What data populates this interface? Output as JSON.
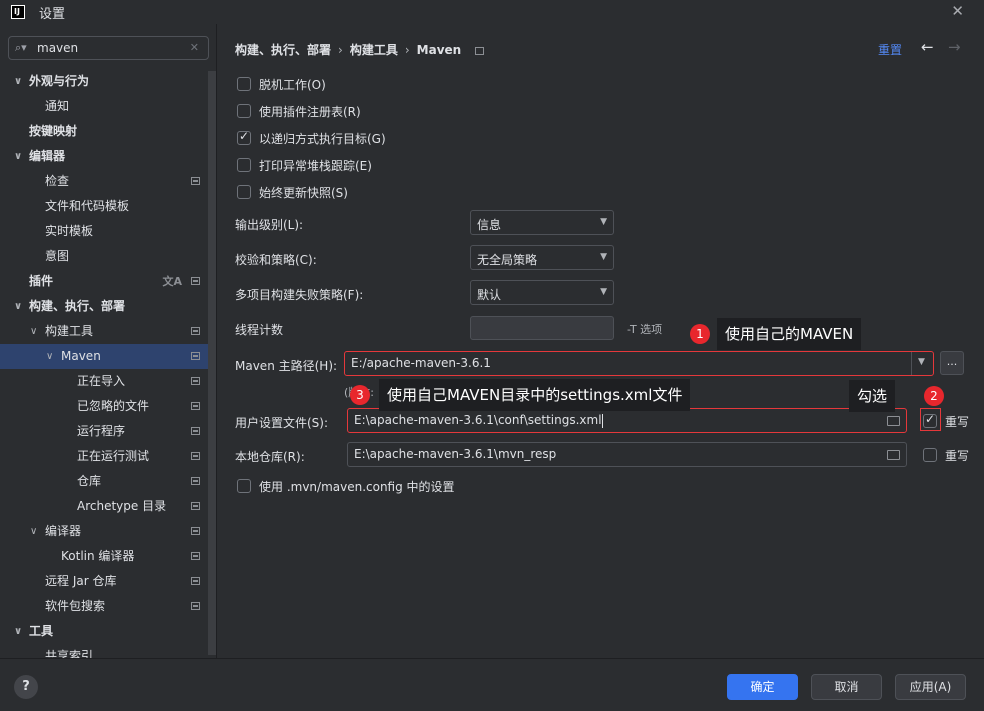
{
  "window": {
    "title": "设置",
    "logo": "IJ"
  },
  "search": {
    "value": "maven"
  },
  "sidebar": {
    "items": [
      {
        "label": "外观与行为",
        "expanded": true,
        "bold": true
      },
      {
        "label": "通知"
      },
      {
        "label": "按键映射",
        "bold": true
      },
      {
        "label": "编辑器",
        "expanded": true,
        "bold": true
      },
      {
        "label": "检查"
      },
      {
        "label": "文件和代码模板"
      },
      {
        "label": "实时模板"
      },
      {
        "label": "意图"
      },
      {
        "label": "插件",
        "bold": true
      },
      {
        "label": "构建、执行、部署",
        "expanded": true,
        "bold": true
      },
      {
        "label": "构建工具",
        "expanded": true
      },
      {
        "label": "Maven",
        "expanded": true,
        "selected": true
      },
      {
        "label": "正在导入"
      },
      {
        "label": "已忽略的文件"
      },
      {
        "label": "运行程序"
      },
      {
        "label": "正在运行测试"
      },
      {
        "label": "仓库"
      },
      {
        "label": "Archetype 目录"
      },
      {
        "label": "编译器",
        "expanded": true
      },
      {
        "label": "Kotlin 编译器"
      },
      {
        "label": "远程 Jar 仓库"
      },
      {
        "label": "软件包搜索"
      },
      {
        "label": "工具",
        "expanded": true,
        "bold": true
      },
      {
        "label": "共享索引"
      }
    ]
  },
  "breadcrumb": {
    "part1": "构建、执行、部署",
    "part2": "构建工具",
    "part3": "Maven",
    "sep": "›"
  },
  "header": {
    "reset": "重置"
  },
  "checkboxes": {
    "offline": "脱机工作(O)",
    "plugin_registry": "使用插件注册表(R)",
    "recursive": "以递归方式执行目标(G)",
    "stacktrace": "打印异常堆栈跟踪(E)",
    "update_snapshots": "始终更新快照(S)"
  },
  "form": {
    "output_level_label": "输出级别(L):",
    "output_level_value": "信息",
    "checksum_label": "校验和策略(C):",
    "checksum_value": "无全局策略",
    "fail_policy_label": "多项目构建失败策略(F):",
    "fail_policy_value": "默认",
    "thread_label": "线程计数",
    "thread_hint": "-T 选项",
    "maven_home_label": "Maven 主路径(H):",
    "maven_home_value": "E:/apache-maven-3.6.1",
    "version_label": "(版本: ",
    "user_settings_label": "用户设置文件(S):",
    "user_settings_value": "E:\\apache-maven-3.6.1\\conf\\settings.xml",
    "local_repo_label": "本地仓库(R):",
    "local_repo_value": "E:\\apache-maven-3.6.1\\mvn_resp",
    "override_label": "重写",
    "mvn_config": "使用 .mvn/maven.config 中的设置"
  },
  "annotations": {
    "n1": "1",
    "c1": "使用自己的MAVEN",
    "n2": "2",
    "c2": "勾选",
    "n3": "3",
    "c3": "使用自己MAVEN目录中的settings.xml文件"
  },
  "footer": {
    "help": "?",
    "ok": "确定",
    "cancel": "取消",
    "apply": "应用(A)"
  },
  "colors": {
    "accent": "#3574f0",
    "selected": "#2e436e",
    "annotation_red": "#e8272d"
  }
}
